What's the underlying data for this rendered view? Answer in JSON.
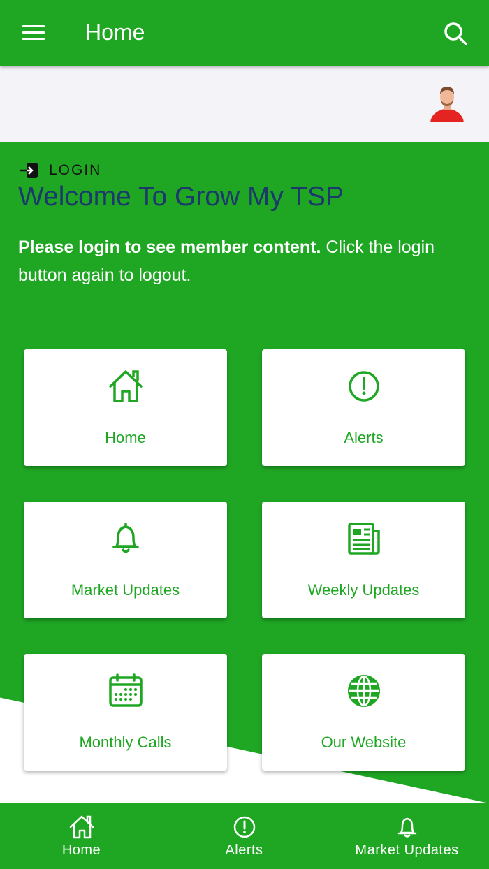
{
  "appbar": {
    "title": "Home",
    "menu_icon": "menu-icon",
    "search_icon": "search-icon"
  },
  "loginbar": {
    "login_label": "LOGIN",
    "login_icon": "login-icon",
    "avatar": "avatar"
  },
  "welcome": {
    "heading": "Welcome To Grow My TSP",
    "intro_bold": "Please login to see member content.",
    "intro_rest": " Click the login button again to logout."
  },
  "tiles": [
    {
      "label": "Home",
      "icon": "home-icon"
    },
    {
      "label": "Alerts",
      "icon": "alert-circle-icon"
    },
    {
      "label": "Market Updates",
      "icon": "bell-icon"
    },
    {
      "label": "Weekly Updates",
      "icon": "newspaper-icon"
    },
    {
      "label": "Monthly Calls",
      "icon": "calendar-icon"
    },
    {
      "label": "Our Website",
      "icon": "globe-icon"
    }
  ],
  "bottom_nav": [
    {
      "label": "Home",
      "icon": "home-icon"
    },
    {
      "label": "Alerts",
      "icon": "alert-circle-icon"
    },
    {
      "label": "Market Updates",
      "icon": "bell-icon"
    }
  ],
  "colors": {
    "primary": "#1fa724",
    "heading": "#1b3a6b",
    "login_bar": "#f3f3f8"
  }
}
